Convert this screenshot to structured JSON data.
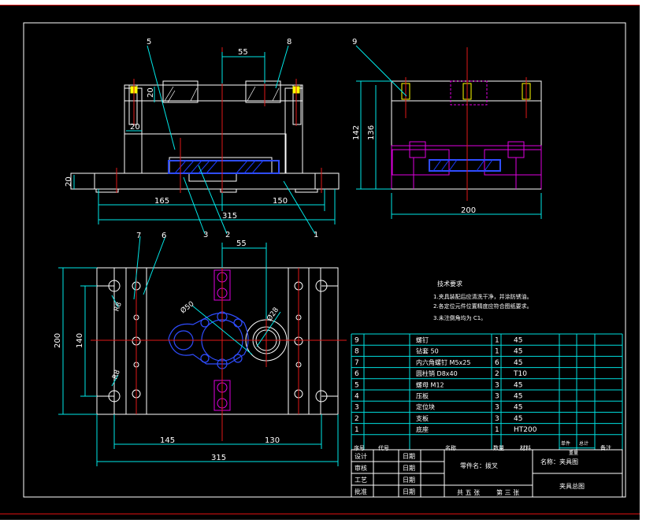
{
  "colors": {
    "outline": "#ffffff",
    "dimension": "#00e8e8",
    "centerline": "#e01818",
    "hatch": "#1a3cff",
    "section": "#e000e0",
    "label": "#00e000",
    "table": "#00e0e0",
    "table_text_yellow": "#ffff00"
  },
  "front_view": {
    "dims": {
      "top_span": "55",
      "bolt_height": "20",
      "post_width": "20",
      "base_height": "20",
      "left_width": "165",
      "right_width": "150",
      "overall_width": "315"
    },
    "callouts": [
      "5",
      "8",
      "3",
      "2",
      "1"
    ]
  },
  "side_view": {
    "dims": {
      "height_outer": "142",
      "height_inner": "136",
      "width": "200"
    },
    "callouts": [
      "9"
    ]
  },
  "top_view": {
    "dims": {
      "top_span": "55",
      "height": "200",
      "inner_height": "140",
      "left_width": "145",
      "right_width": "130",
      "overall_width": "315",
      "r_upper": "R8",
      "r_lower": "R8",
      "dia_large": "Ø50",
      "dia_small": "Ø28"
    },
    "callouts": [
      "7",
      "6"
    ]
  },
  "notes": {
    "title": "技术要求",
    "lines": [
      "1.夹具装配后应清洗干净，并涂防锈油。",
      "2.各定位元件位置精度应符合图纸要求。",
      "3.未注倒角均为 C1。"
    ]
  },
  "bom": {
    "rows": [
      {
        "no": "9",
        "name": "螺钉",
        "qty": "1",
        "material": "45"
      },
      {
        "no": "8",
        "name": "钻套 50",
        "qty": "1",
        "material": "45"
      },
      {
        "no": "7",
        "name": "内六角螺钉 M5x25",
        "qty": "6",
        "material": "45"
      },
      {
        "no": "6",
        "name": "圆柱销 D8x40",
        "qty": "2",
        "material": "T10"
      },
      {
        "no": "5",
        "name": "螺母 M12",
        "qty": "3",
        "material": "45"
      },
      {
        "no": "4",
        "name": "压板",
        "qty": "3",
        "material": "45"
      },
      {
        "no": "3",
        "name": "定位块",
        "qty": "3",
        "material": "45"
      },
      {
        "no": "2",
        "name": "支板",
        "qty": "3",
        "material": "45"
      },
      {
        "no": "1",
        "name": "底座",
        "qty": "1",
        "material": "HT200"
      }
    ],
    "header": {
      "no": "序号",
      "code": "代号",
      "name": "名称",
      "qty": "数量",
      "material": "材料",
      "weight": "重量",
      "remark": "备注",
      "single": "单件",
      "total": "总计"
    }
  },
  "title_block": {
    "left_labels": [
      "设计",
      "审核",
      "工艺",
      "批准"
    ],
    "date_labels": [
      "日期",
      "日期",
      "日期",
      "日期"
    ],
    "part": "零件名：拨叉",
    "name": "名称：夹具图",
    "drawing": "夹具总图",
    "sheets": "共 五 张",
    "sheet_no": "第 三 张"
  }
}
